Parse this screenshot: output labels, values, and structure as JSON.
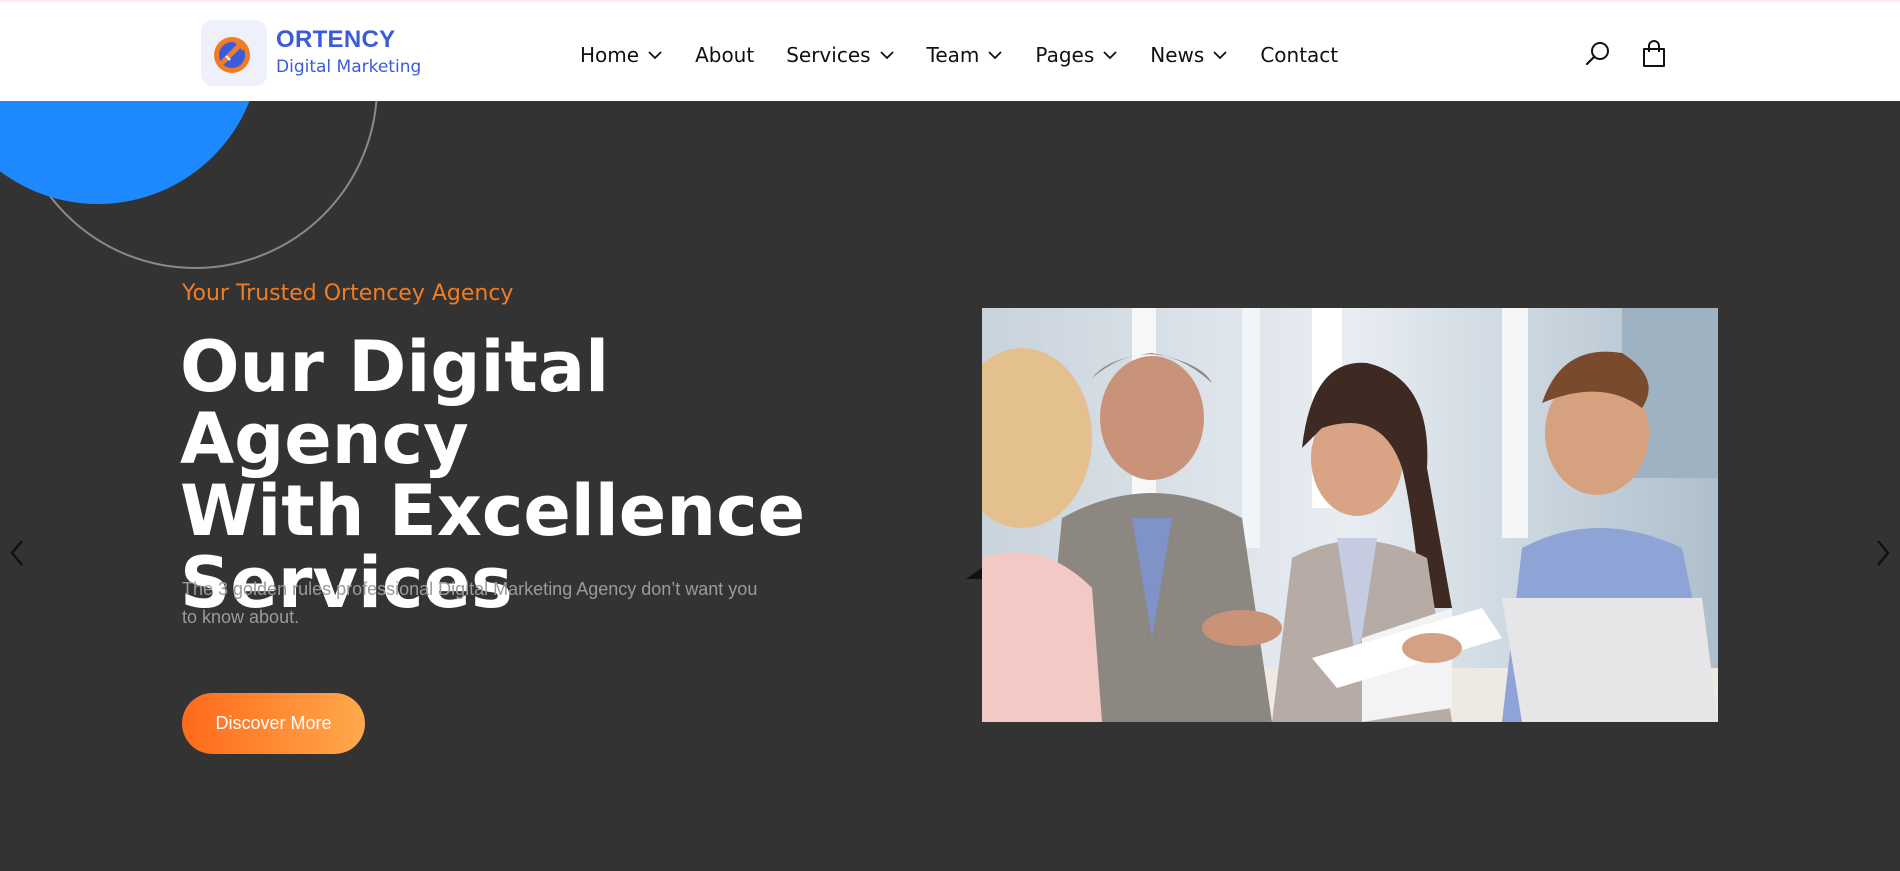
{
  "brand": {
    "name": "ORTENCY",
    "tagline": "Digital Marketing",
    "logo_icon": "rocket-arrow-icon",
    "color": "#3b5bdb"
  },
  "nav": {
    "items": [
      {
        "label": "Home",
        "has_dropdown": true
      },
      {
        "label": "About",
        "has_dropdown": false
      },
      {
        "label": "Services",
        "has_dropdown": true
      },
      {
        "label": "Team",
        "has_dropdown": true
      },
      {
        "label": "Pages",
        "has_dropdown": true
      },
      {
        "label": "News",
        "has_dropdown": true
      },
      {
        "label": "Contact",
        "has_dropdown": false
      }
    ]
  },
  "header_icons": {
    "search": "search-icon",
    "cart": "shopping-bag-icon"
  },
  "hero": {
    "subtitle": "Your Trusted Ortencey Agency",
    "headline_line1": "Our Digital Agency",
    "headline_line2": "With Excellence",
    "headline_line3": "Services",
    "description": "The 3 golden rules professional Digital Marketing Agency don’t want you to know about.",
    "cta_label": "Discover More",
    "image": "business-team-meeting-photo",
    "prev_icon": "chevron-left-icon",
    "next_icon": "chevron-right-icon"
  },
  "colors": {
    "accent": "#f47c20",
    "background": "#333333",
    "header_bg": "#ffffff",
    "blue": "#1e88ff"
  }
}
